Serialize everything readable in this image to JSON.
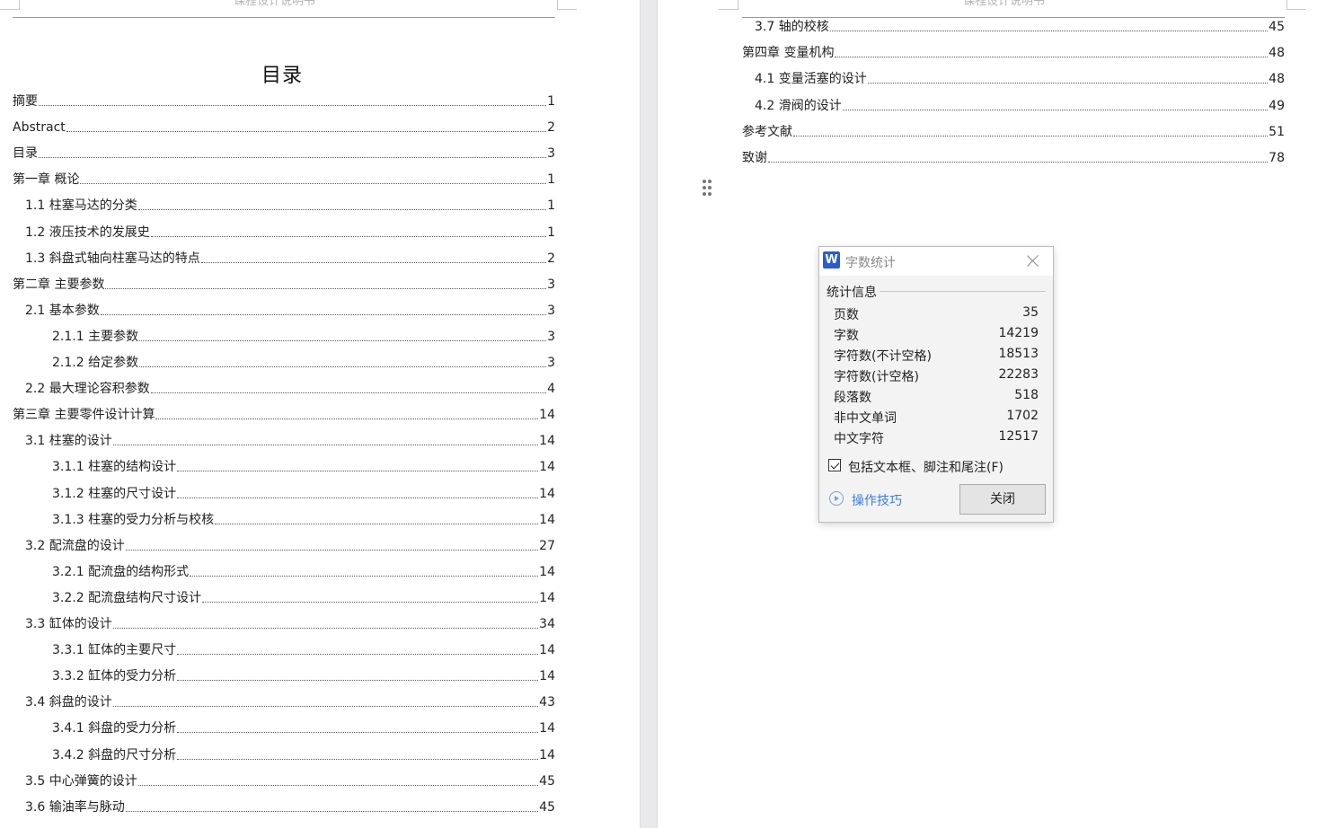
{
  "left_page": {
    "header_text": "课程设计说明书",
    "toc_title": "目录",
    "entries": [
      {
        "label": "摘要",
        "page": "1"
      },
      {
        "label": "Abstract",
        "page": "2"
      },
      {
        "label": "目录",
        "page": "3"
      },
      {
        "label": "第一章  概论",
        "page": "1"
      },
      {
        "label": "1.1  柱塞马达的分类",
        "page": "1"
      },
      {
        "label": "1.2  液压技术的发展史",
        "page": "1"
      },
      {
        "label": "1.3  斜盘式轴向柱塞马达的特点",
        "page": "2"
      },
      {
        "label": "第二章  主要参数",
        "page": "3"
      },
      {
        "label": "2.1 基本参数",
        "page": "3"
      },
      {
        "label": "2.1.1 主要参数",
        "page": "3"
      },
      {
        "label": "2.1.2 给定参数",
        "page": "3"
      },
      {
        "label": "2.2 最大理论容积参数",
        "page": "4"
      },
      {
        "label": "第三章  主要零件设计计算",
        "page": "14"
      },
      {
        "label": "3.1 柱塞的设计",
        "page": "14"
      },
      {
        "label": "3.1.1 柱塞的结构设计",
        "page": "14"
      },
      {
        "label": "3.1.2 柱塞的尺寸设计",
        "page": "14"
      },
      {
        "label": "3.1.3 柱塞的受力分析与校核",
        "page": "14"
      },
      {
        "label": "3.2 配流盘的设计",
        "page": "27"
      },
      {
        "label": "3.2.1 配流盘的结构形式",
        "page": "14"
      },
      {
        "label": "3.2.2 配流盘结构尺寸设计",
        "page": "14"
      },
      {
        "label": "3.3 缸体的设计",
        "page": "34"
      },
      {
        "label": "3.3.1 缸体的主要尺寸",
        "page": "14"
      },
      {
        "label": "3.3.2 缸体的受力分析",
        "page": "14"
      },
      {
        "label": "3.4 斜盘的设计",
        "page": "43"
      },
      {
        "label": "3.4.1 斜盘的受力分析",
        "page": "14"
      },
      {
        "label": "3.4.2 斜盘的尺寸分析",
        "page": "14"
      },
      {
        "label": "3.5 中心弹簧的设计",
        "page": "45"
      },
      {
        "label": "3.6 输油率与脉动",
        "page": "45"
      }
    ]
  },
  "right_page": {
    "header_text": "课程设计说明书",
    "entries": [
      {
        "label": "3.7 轴的校核",
        "page": "45"
      },
      {
        "label": "第四章  变量机构",
        "page": "48"
      },
      {
        "label": "4.1  变量活塞的设计",
        "page": "48"
      },
      {
        "label": "4.2  滑阀的设计",
        "page": "49"
      },
      {
        "label": "参考文献",
        "page": "51"
      },
      {
        "label": "致谢",
        "page": "78"
      }
    ]
  },
  "dialog": {
    "logo": "W",
    "title": "字数统计",
    "group_label": "统计信息",
    "stats": [
      {
        "key": "页数",
        "value": "35"
      },
      {
        "key": "字数",
        "value": "14219"
      },
      {
        "key": "字符数(不计空格)",
        "value": "18513"
      },
      {
        "key": "字符数(计空格)",
        "value": "22283"
      },
      {
        "key": "段落数",
        "value": "518"
      },
      {
        "key": "非中文单词",
        "value": "1702"
      },
      {
        "key": "中文字符",
        "value": "12517"
      }
    ],
    "checkbox_label": "包括文本框、脚注和尾注(F)",
    "checkbox_checked": true,
    "tips_link": "操作技巧",
    "close_button": "关闭"
  }
}
